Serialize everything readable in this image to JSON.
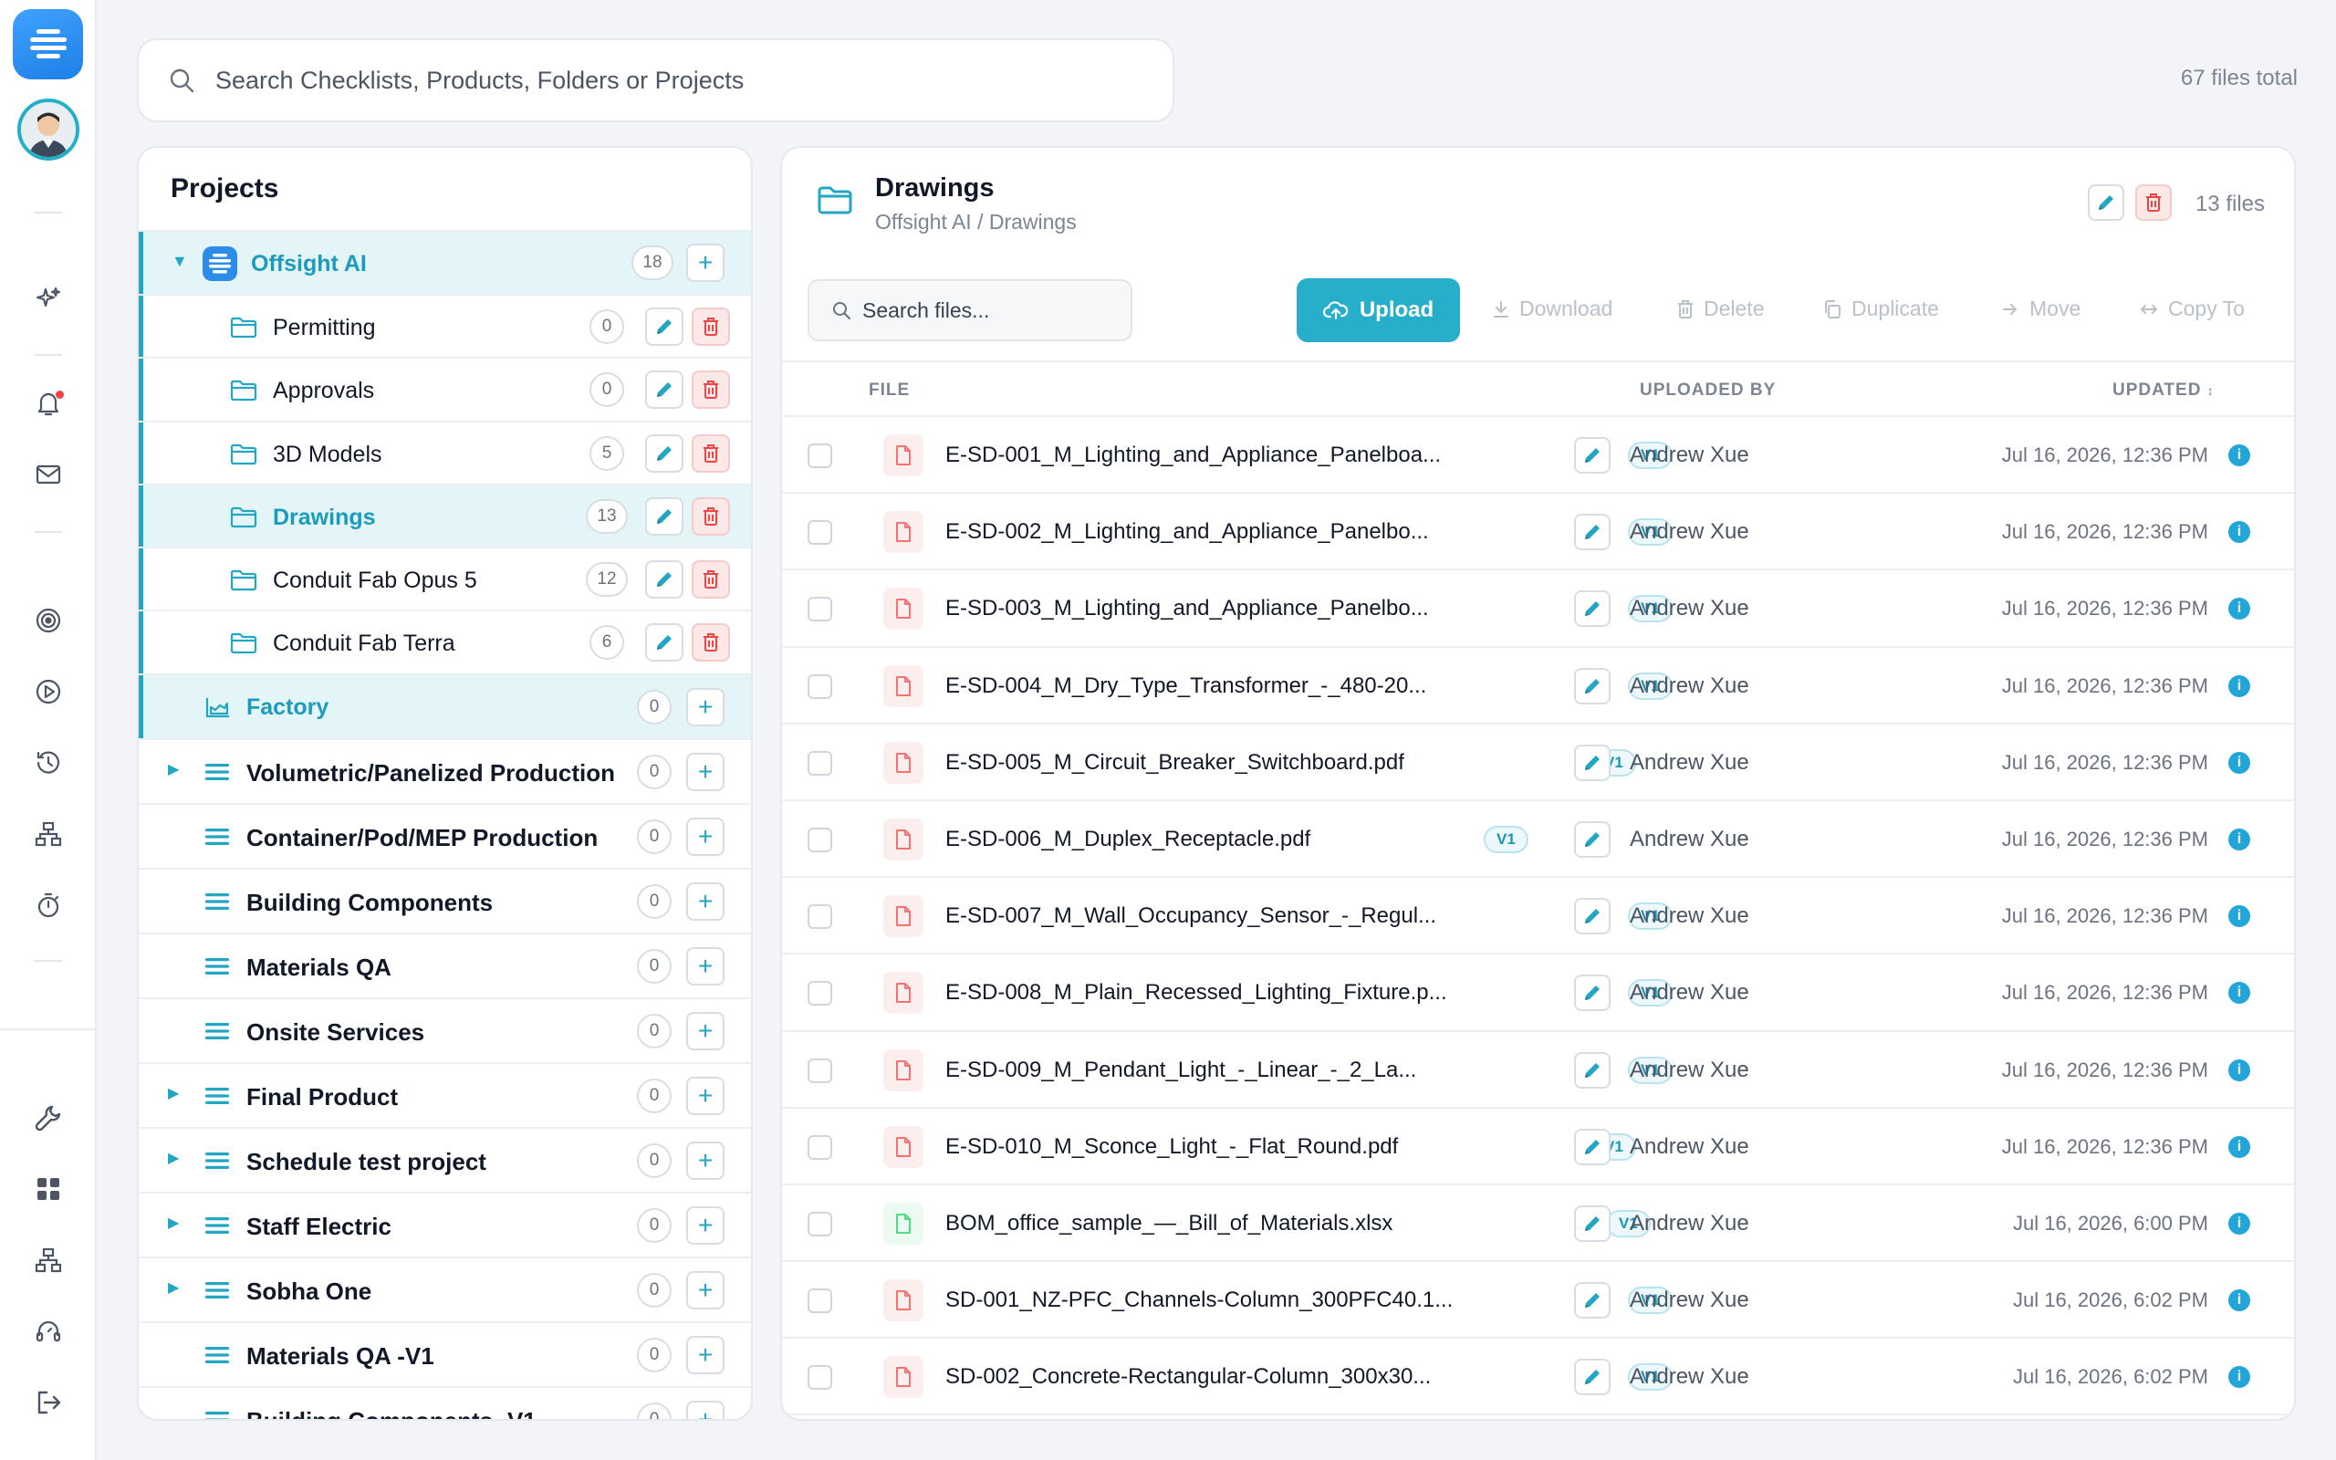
{
  "search": {
    "placeholder": "Search Checklists, Products, Folders or Projects"
  },
  "files_total": "67 files total",
  "projects_panel": {
    "title": "Projects",
    "root": {
      "label": "Offsight AI",
      "count": "18"
    },
    "folders": [
      {
        "label": "Permitting",
        "count": "0"
      },
      {
        "label": "Approvals",
        "count": "0"
      },
      {
        "label": "3D Models",
        "count": "5"
      },
      {
        "label": "Drawings",
        "count": "13"
      },
      {
        "label": "Conduit Fab Opus 5",
        "count": "12"
      },
      {
        "label": "Conduit Fab Terra",
        "count": "6"
      }
    ],
    "factory": {
      "label": "Factory",
      "count": "0"
    },
    "projects": [
      {
        "label": "Volumetric/Panelized Production",
        "count": "0",
        "expandable": true
      },
      {
        "label": "Container/Pod/MEP Production",
        "count": "0",
        "expandable": false
      },
      {
        "label": "Building Components",
        "count": "0",
        "expandable": false
      },
      {
        "label": "Materials QA",
        "count": "0",
        "expandable": false
      },
      {
        "label": "Onsite Services",
        "count": "0",
        "expandable": false
      },
      {
        "label": "Final Product",
        "count": "0",
        "expandable": true
      },
      {
        "label": "Schedule test project",
        "count": "0",
        "expandable": true
      },
      {
        "label": "Staff Electric",
        "count": "0",
        "expandable": true
      },
      {
        "label": "Sobha One",
        "count": "0",
        "expandable": true
      },
      {
        "label": "Materials QA -V1",
        "count": "0",
        "expandable": false
      },
      {
        "label": "Building Components -V1",
        "count": "0",
        "expandable": false
      }
    ]
  },
  "folder_view": {
    "title": "Drawings",
    "path": "Offsight AI / Drawings",
    "count": "13 files",
    "search_placeholder": "Search files...",
    "toolbar": {
      "upload": "Upload",
      "download": "Download",
      "delete": "Delete",
      "duplicate": "Duplicate",
      "move": "Move",
      "copy_to": "Copy To"
    },
    "columns": {
      "file": "FILE",
      "uploaded_by": "UPLOADED BY",
      "updated": "UPDATED"
    },
    "files": [
      {
        "name": "E-SD-001_M_Lighting_and_Appliance_Panelboa...",
        "version": "V1",
        "uploader": "Andrew Xue",
        "updated": "Jul 16, 2026, 12:36 PM",
        "type": "pdf"
      },
      {
        "name": "E-SD-002_M_Lighting_and_Appliance_Panelbo...",
        "version": "V1",
        "uploader": "Andrew Xue",
        "updated": "Jul 16, 2026, 12:36 PM",
        "type": "pdf"
      },
      {
        "name": "E-SD-003_M_Lighting_and_Appliance_Panelbo...",
        "version": "V1",
        "uploader": "Andrew Xue",
        "updated": "Jul 16, 2026, 12:36 PM",
        "type": "pdf"
      },
      {
        "name": "E-SD-004_M_Dry_Type_Transformer_-_480-20...",
        "version": "V1",
        "uploader": "Andrew Xue",
        "updated": "Jul 16, 2026, 12:36 PM",
        "type": "pdf"
      },
      {
        "name": "E-SD-005_M_Circuit_Breaker_Switchboard.pdf",
        "version": "V1",
        "uploader": "Andrew Xue",
        "updated": "Jul 16, 2026, 12:36 PM",
        "type": "pdf"
      },
      {
        "name": "E-SD-006_M_Duplex_Receptacle.pdf",
        "version": "V1",
        "uploader": "Andrew Xue",
        "updated": "Jul 16, 2026, 12:36 PM",
        "type": "pdf"
      },
      {
        "name": "E-SD-007_M_Wall_Occupancy_Sensor_-_Regul...",
        "version": "V1",
        "uploader": "Andrew Xue",
        "updated": "Jul 16, 2026, 12:36 PM",
        "type": "pdf"
      },
      {
        "name": "E-SD-008_M_Plain_Recessed_Lighting_Fixture.p...",
        "version": "V1",
        "uploader": "Andrew Xue",
        "updated": "Jul 16, 2026, 12:36 PM",
        "type": "pdf"
      },
      {
        "name": "E-SD-009_M_Pendant_Light_-_Linear_-_2_La...",
        "version": "V1",
        "uploader": "Andrew Xue",
        "updated": "Jul 16, 2026, 12:36 PM",
        "type": "pdf"
      },
      {
        "name": "E-SD-010_M_Sconce_Light_-_Flat_Round.pdf",
        "version": "V1",
        "uploader": "Andrew Xue",
        "updated": "Jul 16, 2026, 12:36 PM",
        "type": "pdf"
      },
      {
        "name": "BOM_office_sample_—_Bill_of_Materials.xlsx",
        "version": "V1",
        "uploader": "Andrew Xue",
        "updated": "Jul 16, 2026, 6:00 PM",
        "type": "xlsx"
      },
      {
        "name": "SD-001_NZ-PFC_Channels-Column_300PFC40.1...",
        "version": "V1",
        "uploader": "Andrew Xue",
        "updated": "Jul 16, 2026, 6:02 PM",
        "type": "pdf"
      },
      {
        "name": "SD-002_Concrete-Rectangular-Column_300x30...",
        "version": "V1",
        "uploader": "Andrew Xue",
        "updated": "Jul 16, 2026, 6:02 PM",
        "type": "pdf"
      }
    ]
  },
  "colors": {
    "accent": "#26aecb",
    "delete": "#ef4444",
    "pdf": "#f87171",
    "xlsx": "#4ade80"
  }
}
